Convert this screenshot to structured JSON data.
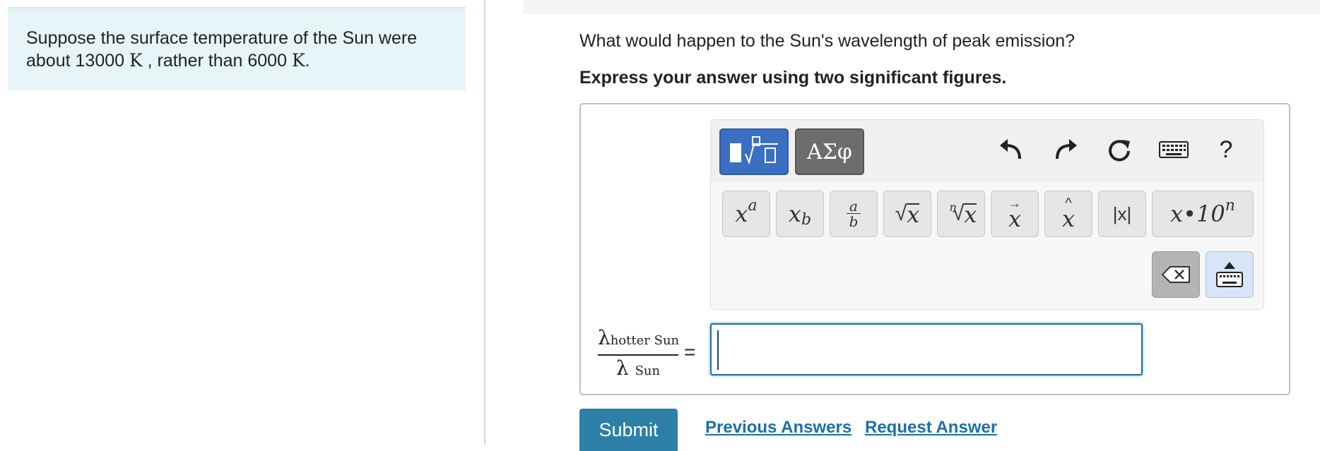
{
  "problem": {
    "line1": "Suppose the surface temperature of the Sun were",
    "line2_prefix": "about 13000 ",
    "unit": "K",
    "line2_mid": " , rather than 6000 ",
    "line2_suffix": "."
  },
  "question": "What would happen to the Sun's wavelength of peak emission?",
  "instruction": "Express your answer using two significant figures.",
  "toolbar": {
    "tab_templates_icon": "templates-icon",
    "tab_symbols_label": "ΑΣφ",
    "help_label": "?",
    "icons": [
      "undo-icon",
      "redo-icon",
      "reset-icon",
      "keyboard-icon",
      "help-icon"
    ],
    "keys": {
      "superscript_base": "x",
      "superscript_exp": "a",
      "subscript_base": "x",
      "subscript_sub": "b",
      "fraction_num": "a",
      "fraction_den": "b",
      "sqrt_radicand": "x",
      "nthroot_index": "n",
      "nthroot_radicand": "x",
      "vector_base": "x",
      "hat_base": "x",
      "abs_label": "|x|",
      "sci_label": "x•10",
      "sci_exp": "n"
    },
    "accent_color": "#3b6fc2"
  },
  "answer": {
    "numerator_symbol": "λ",
    "numerator_sub": "hotter Sun",
    "denominator_symbol": "λ",
    "denominator_sub": "Sun",
    "equals": "=",
    "value": ""
  },
  "actions": {
    "submit_label": "Submit",
    "previous_label": "Previous Answers",
    "request_label": "Request Answer"
  }
}
